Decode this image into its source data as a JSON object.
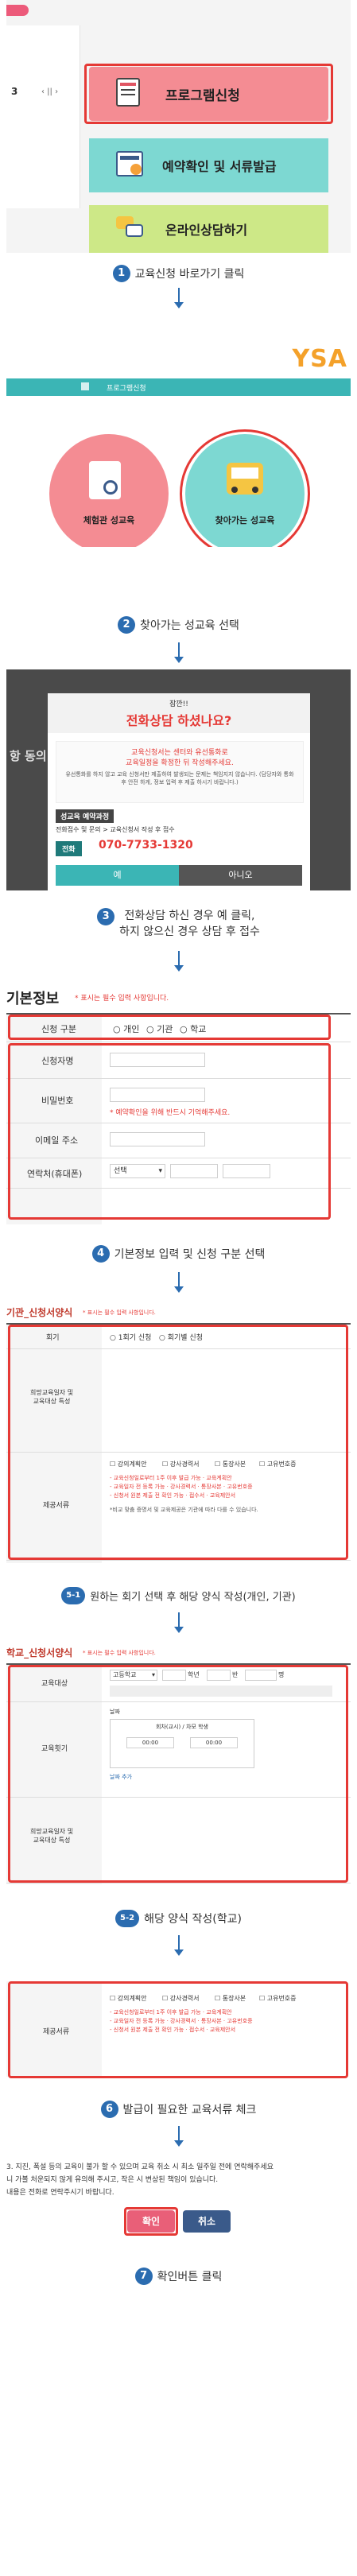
{
  "panel1": {
    "page_num": "3",
    "pager": "‹ ||  ›",
    "menu": [
      {
        "label": "프로그램신청",
        "icon": "calendar-icon",
        "color": "#f48c93"
      },
      {
        "label": "예약확인 및 서류발급",
        "icon": "calendar-check-icon",
        "color": "#7dd8d2"
      },
      {
        "label": "온라인상담하기",
        "icon": "chat-icon",
        "color": "#cde887"
      }
    ]
  },
  "steps": [
    {
      "n": "1",
      "text": "교육신청 바로가기 클릭"
    },
    {
      "n": "2",
      "text": "찾아가는 성교육 선택"
    },
    {
      "n": "3",
      "text": "전화상담 하신 경우 예 클릭,\n하지 않으신 경우 상담 후 접수"
    },
    {
      "n": "4",
      "text": "기본정보 입력 및 신청 구분 선택"
    },
    {
      "n": "5-1",
      "text": "원하는 회기 선택 후 해당 양식 작성(개인, 기관)"
    },
    {
      "n": "5-2",
      "text": "해당 양식 작성(학교)"
    },
    {
      "n": "6",
      "text": "발급이 필요한 교육서류 체크"
    },
    {
      "n": "7",
      "text": "확인버튼 클릭"
    }
  ],
  "panel2": {
    "nav_label": "프로그램신청",
    "logo": "YSA",
    "card_left": "체험관 성교육",
    "card_right": "찾아가는 성교육"
  },
  "panel3": {
    "title_small": "잠깐!!",
    "title": "전화상담 하셨나요?",
    "bg_left": "항 동의",
    "notice1": "교육신청서는 센터와 유선통화로\n교육일정을 확정한 뒤 작성해주세요.",
    "notice2": "유선통화를 하지 않고 교육 신청서만 제출하여 발생되는 문제는 책임지지 않습니다. (담당자와 통화 후 안전 하게, 정보 입력 후 제출 하시기 바랍니다.)",
    "section_label": "성교육 예약과정",
    "section_text": "전화접수 및 문의 > 교육신청서 작성 후 접수",
    "phone_label": "전화",
    "phone": "070-7733-1320",
    "yes": "예",
    "no": "아니오"
  },
  "panel4": {
    "title": "기본정보",
    "required_note": "* 표시는 필수 입력 사항입니다.",
    "rows": [
      "신청 구분",
      "신청자명",
      "비밀번호",
      "이메일 주소",
      "연락처(휴대폰)"
    ],
    "radios": [
      "개인",
      "기관",
      "학교"
    ],
    "pw_hint": "* 예약확인을 위해 반드시 기억해주세요.",
    "select": "선택"
  },
  "panel5": {
    "title": "기관_신청서양식",
    "note": "* 표시는 필수 입력 사항입니다.",
    "row1": "회기",
    "opt1": "1회기 신청",
    "opt2": "회기별 신청",
    "row2": "희망교육일자 및\n교육대상 특성",
    "row3": "제공서류",
    "docs": [
      "강의계획안",
      "강사경력서",
      "통장사본",
      "고유번호증"
    ],
    "doc_notes": "- 교육신청일로부터 1주 이후 발급 가능 · 교육계획안\n- 교육일자 전 등록 가능 · 강사경력서 · 통장사본 · 고유번호증\n- 신청서 원본 제출 전 확인 가능 · 접수서 · 교육제안서",
    "extra": "*비교 맞춤 증명서 및 교육제공은 기관에 따라 다를 수 있습니다."
  },
  "panel6": {
    "title": "학교_신청서양식",
    "note": "* 표시는 필수 입력 사항입니다.",
    "row1": "교육대상",
    "row2": "교육횟기",
    "row3": "희망교육일자 및\n교육대상 특성",
    "school_select": "고등학교",
    "grade": "학년",
    "class": "반",
    "students": "명",
    "time_label": "회차(교시) / 차모 학생",
    "time1": "00:00",
    "time2": "00:00",
    "date_label": "날짜",
    "add": "날짜 추가"
  },
  "panel7": {
    "row_label": "제공서류",
    "docs": [
      "강의계획안",
      "강사경력서",
      "통장사본",
      "고유번호증"
    ],
    "doc_notes": "- 교육신청일로부터 1주 이후 발급 가능 · 교육계획안\n- 교육일자 전 등록 가능 · 강사경력서 · 통장사본 · 고유번호증\n- 신청서 원본 제출 전 확인 가능 · 접수서 · 교육제안서"
  },
  "panel8": {
    "text1": "3. 지진, 폭설 등의 교육이 불가 할 수 있으며 교육 취소 시 최소 일주일 전에 연락해주세요",
    "text2": "니 가볼 처운되지 않게 유의해 주시고, 작은 시 변상된 책임이 있습니다.",
    "text3": "내용은 전화로 연락주시기 바랍니다.",
    "confirm": "확인",
    "cancel": "취소"
  }
}
